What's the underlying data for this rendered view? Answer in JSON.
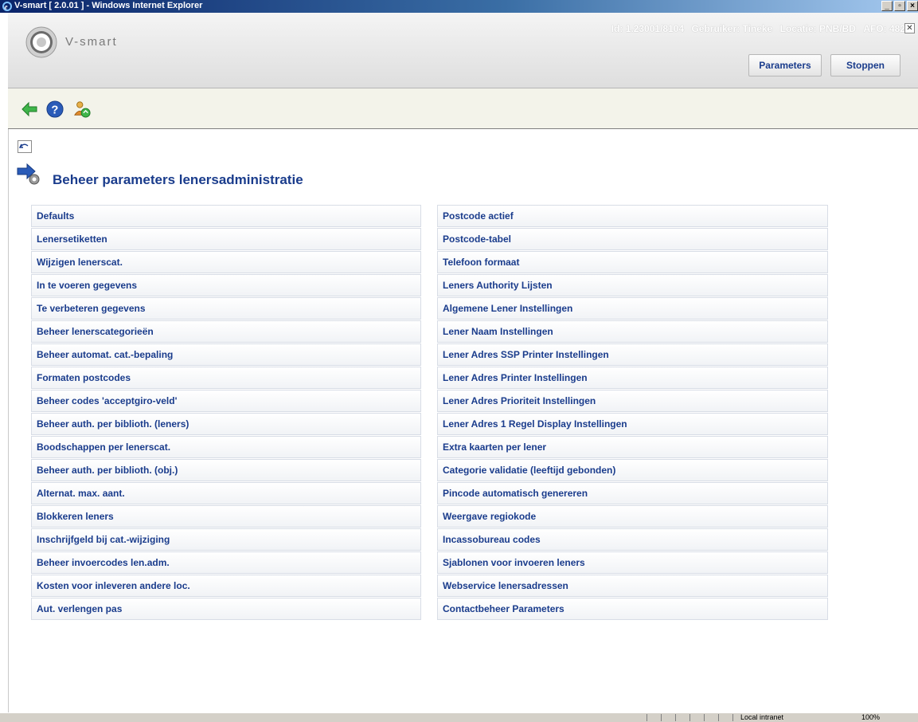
{
  "window": {
    "title": "V-smart [ 2.0.01 ] - Windows Internet Explorer"
  },
  "app": {
    "brand": "V-smart"
  },
  "session": {
    "id": "Id: 1.23001/8104",
    "user": "Gebruiker: Tineke",
    "location": "Locatie: PNB/BD",
    "afo": "AFO: 482"
  },
  "header_buttons": {
    "parameters": "Parameters",
    "stop": "Stoppen"
  },
  "toolbar": {
    "icons": [
      "back-arrow-icon",
      "help-icon",
      "user-switch-icon"
    ]
  },
  "page": {
    "title": "Beheer parameters lenersadministratie"
  },
  "menu": {
    "left": [
      "Defaults",
      "Lenersetiketten",
      "Wijzigen lenerscat.",
      "In te voeren gegevens",
      "Te verbeteren gegevens",
      "Beheer lenerscategorieën",
      "Beheer automat. cat.-bepaling",
      "Formaten postcodes",
      "Beheer codes 'acceptgiro-veld'",
      "Beheer auth. per biblioth. (leners)",
      "Boodschappen per lenerscat.",
      "Beheer auth. per biblioth. (obj.)",
      "Alternat. max. aant.",
      "Blokkeren leners",
      "Inschrijfgeld bij cat.-wijziging",
      "Beheer invoercodes len.adm.",
      "Kosten voor inleveren andere loc.",
      "Aut. verlengen pas"
    ],
    "right": [
      "Postcode actief",
      "Postcode-tabel",
      "Telefoon formaat",
      "Leners Authority Lijsten",
      "Algemene Lener Instellingen",
      "Lener Naam Instellingen",
      "Lener Adres SSP Printer Instellingen",
      "Lener Adres Printer Instellingen",
      "Lener Adres Prioriteit Instellingen",
      "Lener Adres 1 Regel Display Instellingen",
      "Extra kaarten per lener",
      "Categorie validatie (leeftijd gebonden)",
      "Pincode automatisch genereren",
      "Weergave regiokode",
      "Incassobureau codes",
      "Sjablonen voor invoeren leners",
      "Webservice lenersadressen",
      "Contactbeheer Parameters"
    ]
  },
  "statusbar": {
    "zone": "Local intranet",
    "zoom": "100%"
  },
  "colors": {
    "link": "#1a3c8c",
    "titlebar": "#0a246a",
    "toolbar_bg": "#f3f3ea"
  }
}
